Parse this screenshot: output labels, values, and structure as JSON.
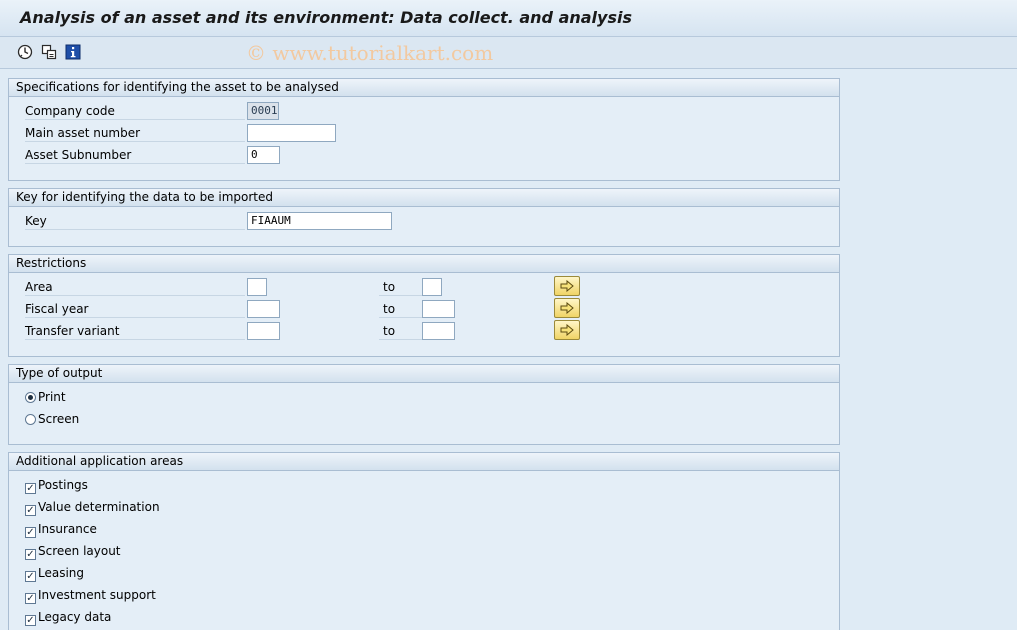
{
  "title": "Analysis of an asset and its environment: Data collect. and analysis",
  "toolbar": {
    "watermark": "© www.tutorialkart.com",
    "icons": [
      "execute-icon",
      "get-variant-icon",
      "info-icon"
    ]
  },
  "spec": {
    "header": "Specifications for identifying the asset to be analysed",
    "company_code_label": "Company code",
    "company_code_value": "0001",
    "main_asset_label": "Main asset number",
    "main_asset_value": "",
    "subnumber_label": "Asset Subnumber",
    "subnumber_value": "0"
  },
  "key": {
    "header": "Key for identifying the data to be imported",
    "key_label": "Key",
    "key_value": "FIAAUM"
  },
  "restrictions": {
    "header": "Restrictions",
    "to_label": "to",
    "rows": [
      {
        "label": "Area",
        "from": "",
        "to": ""
      },
      {
        "label": "Fiscal year",
        "from": "",
        "to": ""
      },
      {
        "label": "Transfer variant",
        "from": "",
        "to": ""
      }
    ]
  },
  "output": {
    "header": "Type of output",
    "options": [
      {
        "label": "Print",
        "selected": true
      },
      {
        "label": "Screen",
        "selected": false
      }
    ]
  },
  "areas": {
    "header": "Additional application areas",
    "items": [
      {
        "label": "Postings",
        "checked": true
      },
      {
        "label": "Value determination",
        "checked": true
      },
      {
        "label": "Insurance",
        "checked": true
      },
      {
        "label": "Screen layout",
        "checked": true
      },
      {
        "label": "Leasing",
        "checked": true
      },
      {
        "label": "Investment support",
        "checked": true
      },
      {
        "label": "Legacy data",
        "checked": true
      }
    ]
  },
  "colors": {
    "background": "#dfebf5",
    "arrow_button": "#f0d466",
    "watermark": "#f2c9a0"
  }
}
